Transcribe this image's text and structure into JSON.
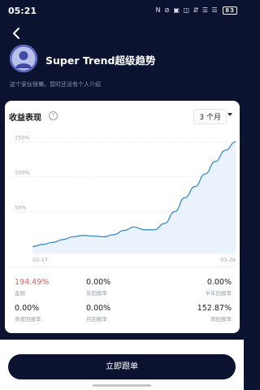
{
  "status_bar": {
    "time": "05:21",
    "icons_text": "N ⊘ ▣ ◫ ⇵ ☰ ☰",
    "battery": "83"
  },
  "header": {
    "title": "Super Trend超级趋势",
    "bio": "这个家伙很懒，暂时还没有个人介绍"
  },
  "performance": {
    "label": "收益表现",
    "help_icon": "?",
    "period": "3 个月"
  },
  "chart_data": {
    "type": "area",
    "y_ticks": [
      "150%",
      "100%",
      "50%"
    ],
    "x_tick_labels": [
      "03-17",
      "03-28"
    ],
    "ylim": [
      -10,
      160
    ],
    "grid": true,
    "series_color": "#3a8bc8",
    "fill_color": "#e9f2fd",
    "values": [
      0,
      3,
      6,
      10,
      14,
      16,
      15,
      14,
      17,
      23,
      28,
      24,
      24,
      33,
      50,
      70,
      86,
      104,
      122,
      138,
      150
    ]
  },
  "stats": [
    {
      "value": "194.49%",
      "label": "金额"
    },
    {
      "value": "0.00%",
      "label": "年回报率"
    },
    {
      "value": "0.00%",
      "label": "半年回报率"
    },
    {
      "value": "0.00%",
      "label": "季度回报率"
    },
    {
      "value": "0.00%",
      "label": "月回报率"
    },
    {
      "value": "152.87%",
      "label": "周回报率"
    }
  ],
  "colors": {
    "positive": "#e35b5b",
    "neutral": "#1c1c1c",
    "brand_dark": "#0b1330"
  },
  "cta_label": "立即跟单"
}
